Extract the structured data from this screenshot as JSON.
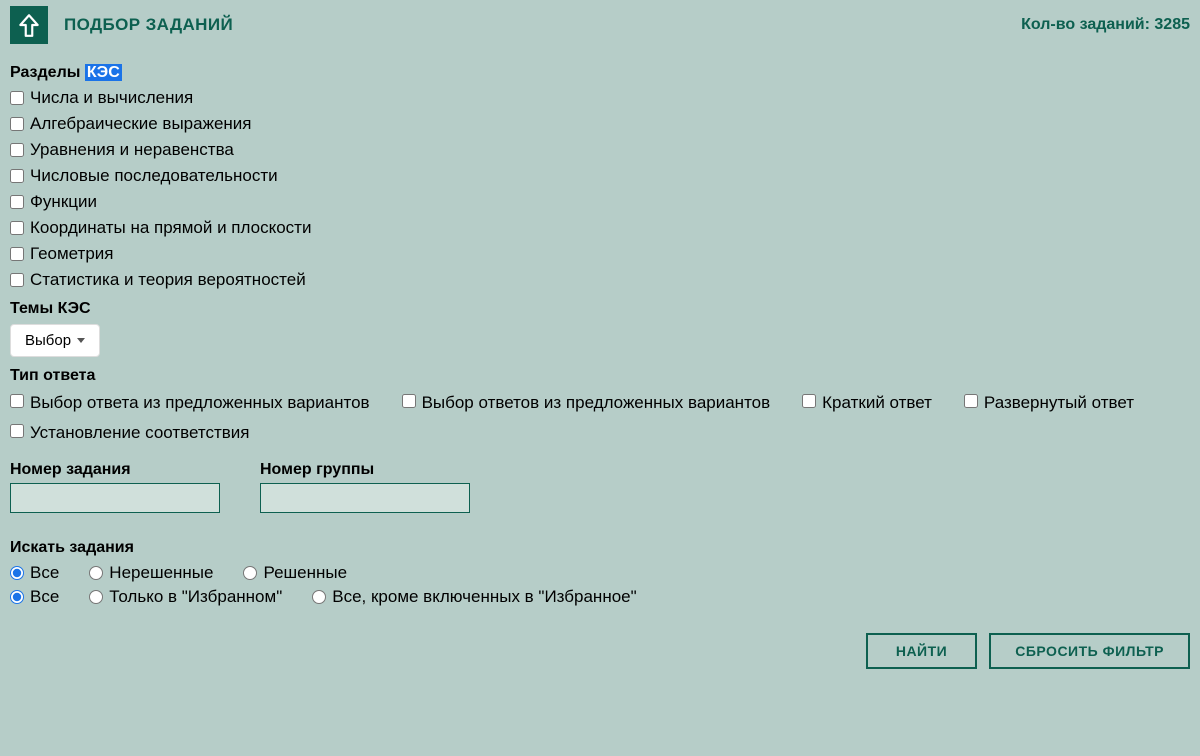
{
  "header": {
    "title": "ПОДБОР ЗАДАНИЙ",
    "count_label": "Кол-во заданий:",
    "count_value": "3285"
  },
  "sections_label_prefix": "Разделы ",
  "sections_label_highlight": "КЭС",
  "sections": [
    "Числа и вычисления",
    "Алгебраические выражения",
    "Уравнения и неравенства",
    "Числовые последовательности",
    "Функции",
    "Координаты на прямой и плоскости",
    "Геометрия",
    "Статистика и теория вероятностей"
  ],
  "themes_label": "Темы КЭС",
  "themes_select": "Выбор",
  "answer_type_label": "Тип ответа",
  "answer_types": [
    "Выбор ответа из предложенных вариантов",
    "Выбор ответов из предложенных вариантов",
    "Краткий ответ",
    "Развернутый ответ",
    "Установление соответствия"
  ],
  "task_number_label": "Номер задания",
  "group_number_label": "Номер группы",
  "search_label": "Искать задания",
  "radio_solved": [
    "Все",
    "Нерешенные",
    "Решенные"
  ],
  "radio_fav": [
    "Все",
    "Только в \"Избранном\"",
    "Все, кроме включенных в \"Избранное\""
  ],
  "buttons": {
    "find": "НАЙТИ",
    "reset": "СБРОСИТЬ ФИЛЬТР"
  }
}
